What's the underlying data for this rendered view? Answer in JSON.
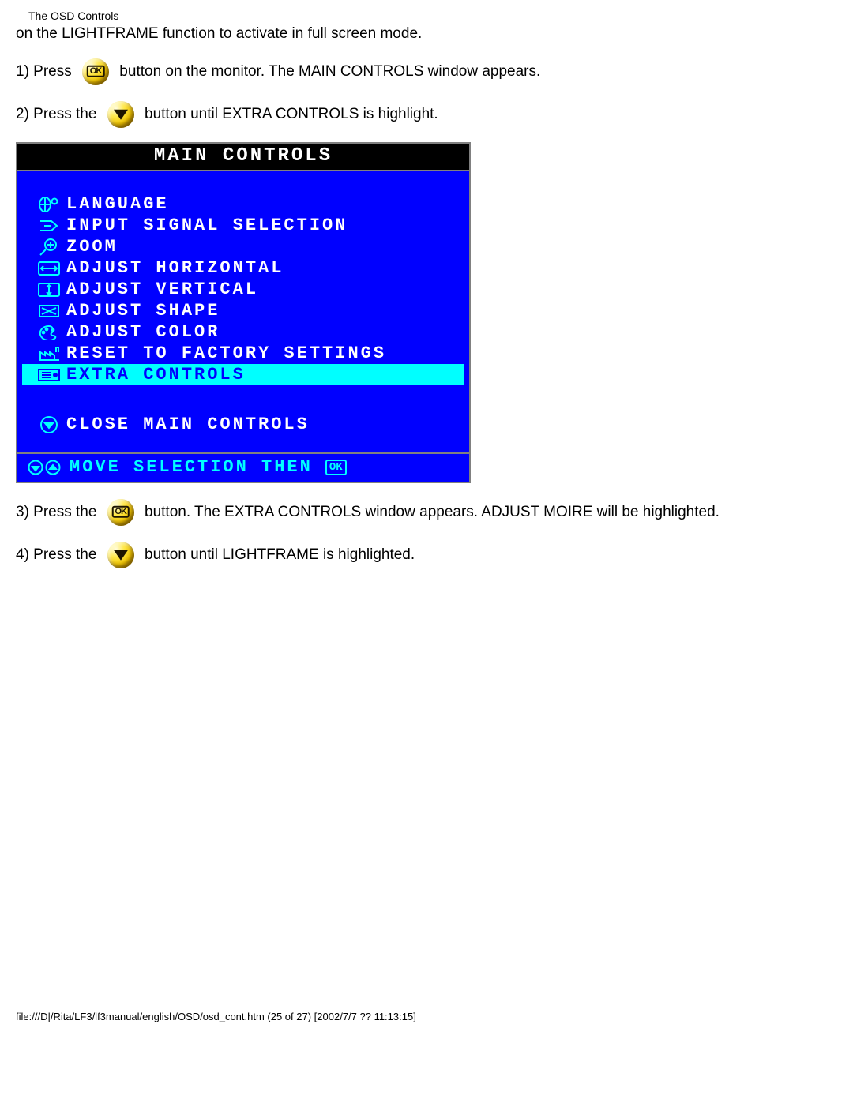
{
  "header": {
    "title": "The OSD Controls"
  },
  "intro_line": "on the LIGHTFRAME function to activate in full screen mode.",
  "steps": {
    "s1": {
      "num": "1) Press ",
      "tail": " button on the monitor. The MAIN CONTROLS window appears."
    },
    "s2": {
      "num": "2) Press the ",
      "tail": " button until EXTRA CONTROLS is highlight."
    },
    "s3": {
      "num": "3) Press the ",
      "tail": " button. The EXTRA CONTROLS window appears. ADJUST MOIRE will be highlighted."
    },
    "s4": {
      "num": "4) Press the ",
      "tail": " button until LIGHTFRAME is highlighted."
    }
  },
  "buttons": {
    "ok_label": "OK"
  },
  "osd": {
    "title": "MAIN CONTROLS",
    "items": [
      {
        "label": "LANGUAGE"
      },
      {
        "label": "INPUT SIGNAL SELECTION"
      },
      {
        "label": "ZOOM"
      },
      {
        "label": "ADJUST HORIZONTAL"
      },
      {
        "label": "ADJUST VERTICAL"
      },
      {
        "label": "ADJUST SHAPE"
      },
      {
        "label": "ADJUST COLOR"
      },
      {
        "label": "RESET TO FACTORY SETTINGS"
      },
      {
        "label": "EXTRA CONTROLS"
      }
    ],
    "close_label": "CLOSE MAIN CONTROLS",
    "hint_text": "MOVE SELECTION THEN",
    "hint_ok": "OK"
  },
  "footer": "file:///D|/Rita/LF3/lf3manual/english/OSD/osd_cont.htm (25 of 27) [2002/7/7 ?? 11:13:15]"
}
